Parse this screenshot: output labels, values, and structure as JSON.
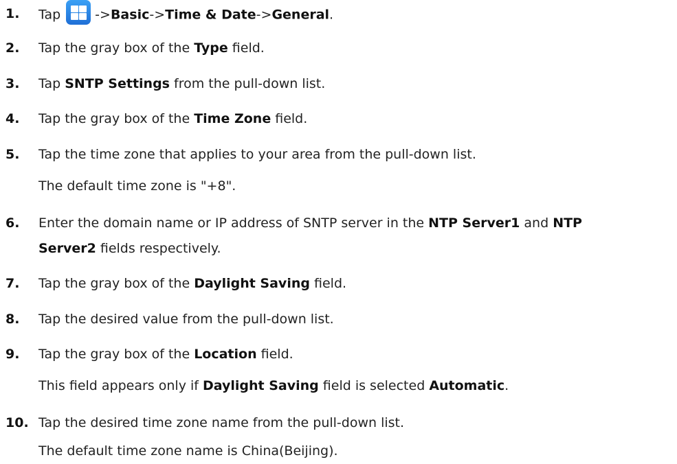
{
  "steps": [
    {
      "num": "1.",
      "t0": "Tap",
      "b0": "->",
      "path1": "Basic",
      "sep1": "->",
      "path2": "Time & Date",
      "sep2": "->",
      "path3": "General",
      "end": "."
    },
    {
      "num": "2.",
      "t0": "Tap the gray box of the ",
      "b0": "Type",
      "t1": " field."
    },
    {
      "num": "3.",
      "t0": "Tap ",
      "b0": "SNTP Settings",
      "t1": " from the pull-down list."
    },
    {
      "num": "4.",
      "t0": "Tap the gray box of the ",
      "b0": "Time Zone",
      "t1": " field."
    },
    {
      "num": "5.",
      "t0": "Tap the time zone that applies to your area from the pull-down list."
    },
    {
      "num": "6.",
      "t0": "Enter the domain name or IP address of SNTP server in the ",
      "b0": "NTP Server1",
      "t1": " and ",
      "b1": "NTP"
    },
    {
      "num": "7.",
      "t0": "Tap the gray box of the ",
      "b0": "Daylight Saving",
      "t1": " field."
    },
    {
      "num": "8.",
      "t0": "Tap the desired value from the pull-down list."
    },
    {
      "num": "9.",
      "t0": "Tap the gray box of the ",
      "b0": "Location",
      "t1": " field."
    },
    {
      "num": "10.",
      "t0": "Tap the desired time zone name from the pull-down list."
    }
  ],
  "notes": {
    "step5": "The default time zone is \"+8\".",
    "step6_b": "Server2",
    "step6_t": " fields respectively.",
    "step9_t0": "This field appears only if ",
    "step9_b0": "Daylight Saving",
    "step9_t1": " field is selected ",
    "step9_b1": "Automatic",
    "step9_end": ".",
    "step10": "The default time zone name is China(Beijing)."
  },
  "icon": "apps-grid-icon"
}
